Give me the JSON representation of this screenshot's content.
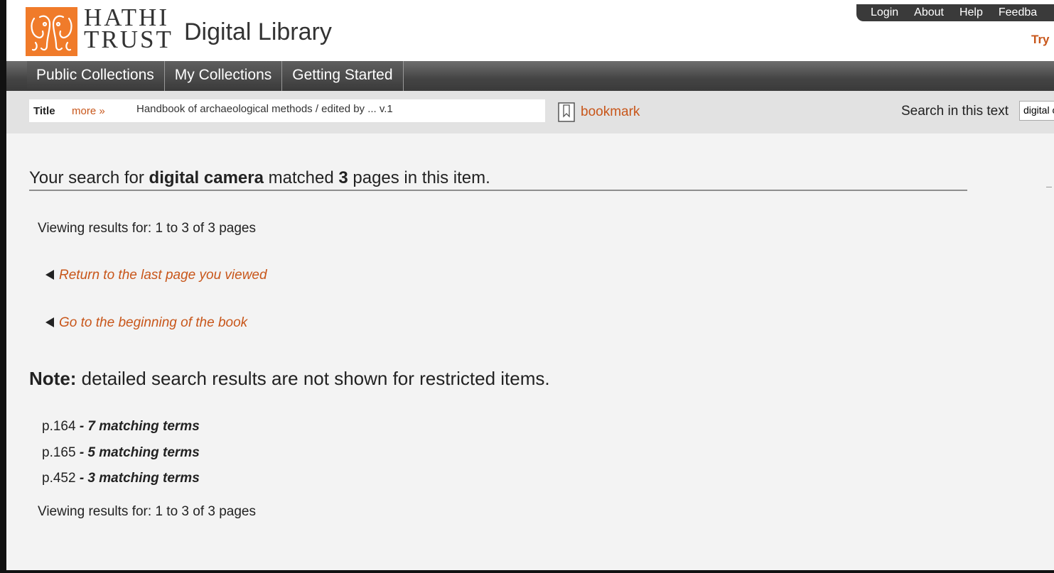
{
  "header": {
    "logo_line1": "HATHI",
    "logo_line2": "TRUST",
    "site_title": "Digital Library",
    "top_links": [
      "Login",
      "About",
      "Help",
      "Feedba"
    ],
    "try_link": "Try"
  },
  "nav": {
    "tabs": [
      "Public Collections",
      "My Collections",
      "Getting Started"
    ]
  },
  "titlebar": {
    "label": "Title",
    "more": "more »",
    "value": "Handbook of archaeological methods / edited by ... v.1",
    "bookmark": "bookmark",
    "search_label": "Search in this text",
    "search_value": "digital camera"
  },
  "results": {
    "heading_prefix": "Your search for ",
    "query": "digital camera",
    "heading_mid": " matched ",
    "count": "3",
    "heading_suffix": " pages in this item.",
    "viewing_top": "Viewing results for: 1 to 3 of 3 pages",
    "return_link": "Return to the last page you viewed",
    "beginning_link": "Go to the beginning of the book",
    "note_label": "Note:",
    "note_text": " detailed search results are not shown for restricted items.",
    "items": [
      {
        "page": "p.164",
        "terms": " - 7 matching terms"
      },
      {
        "page": "p.165",
        "terms": " - 5 matching terms"
      },
      {
        "page": "p.452",
        "terms": " - 3 matching terms"
      }
    ],
    "viewing_bottom": "Viewing results for: 1 to 3 of 3 pages"
  },
  "colors": {
    "brand_orange": "#f07b2a",
    "link": "#c8561a",
    "nav_dark": "#3a3a3a"
  }
}
